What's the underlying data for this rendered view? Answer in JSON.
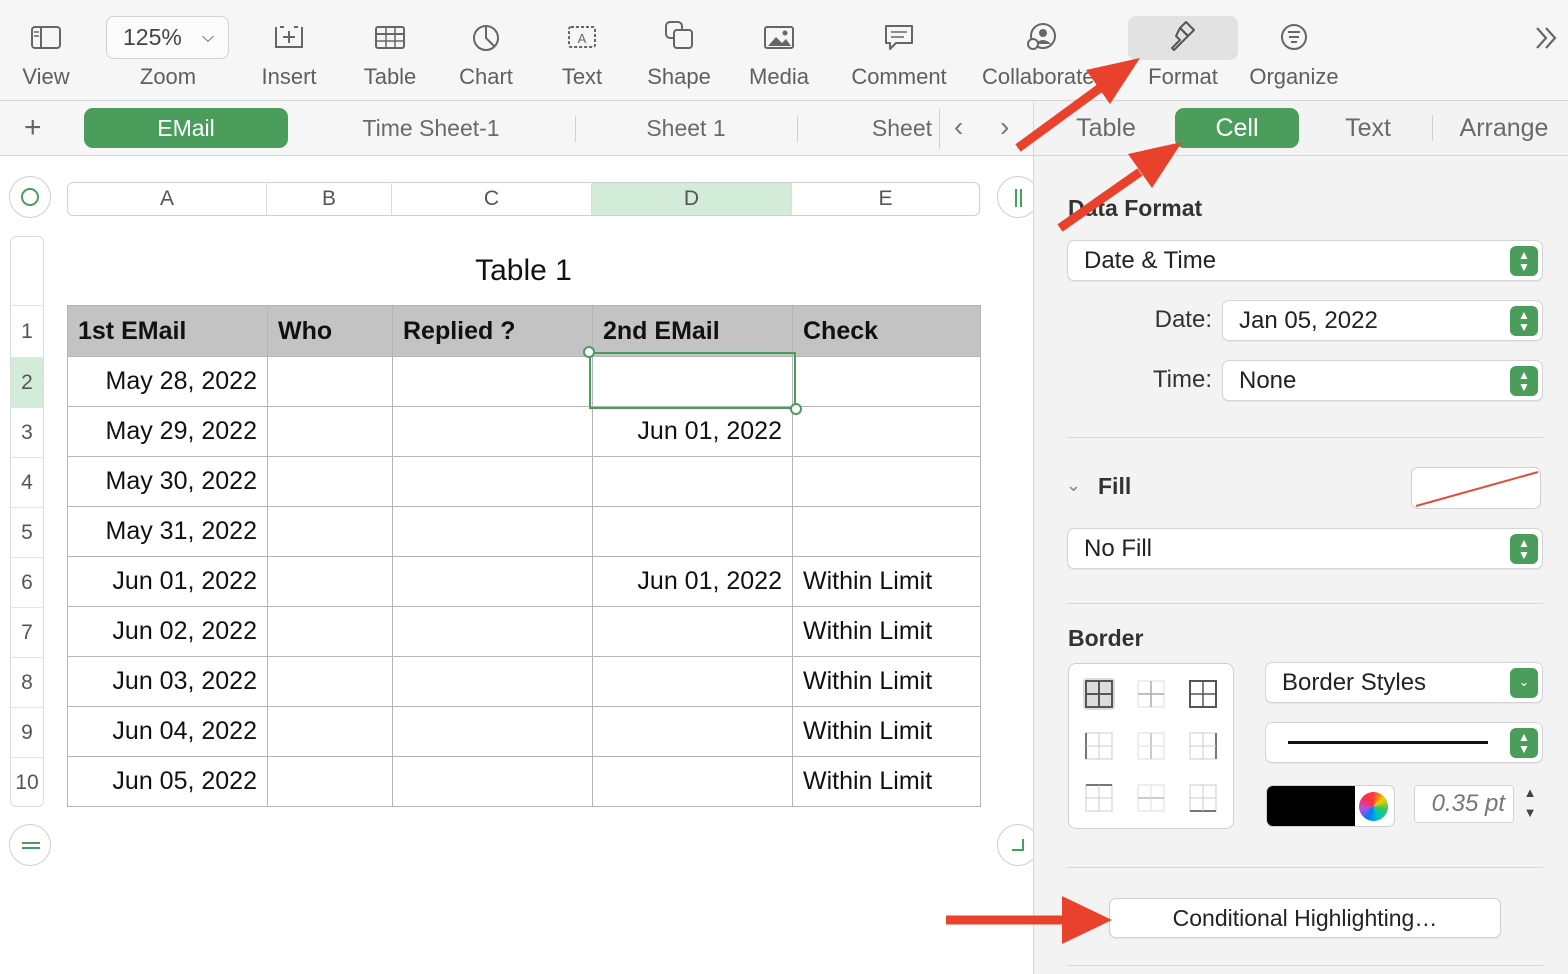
{
  "toolbar": {
    "zoom_value": "125%",
    "items": [
      {
        "label": "View",
        "icon": "sidebar-icon"
      },
      {
        "label": "Zoom"
      },
      {
        "label": "Insert",
        "icon": "insert-icon"
      },
      {
        "label": "Table",
        "icon": "table-icon"
      },
      {
        "label": "Chart",
        "icon": "chart-icon"
      },
      {
        "label": "Text",
        "icon": "text-icon"
      },
      {
        "label": "Shape",
        "icon": "shape-icon"
      },
      {
        "label": "Media",
        "icon": "media-icon"
      },
      {
        "label": "Comment",
        "icon": "comment-icon"
      },
      {
        "label": "Collaborate",
        "icon": "collaborate-icon"
      },
      {
        "label": "Format",
        "icon": "paintbrush-icon"
      },
      {
        "label": "Organize",
        "icon": "organize-icon"
      }
    ],
    "more_icon": "double-chevron-icon"
  },
  "sheets": {
    "tabs": [
      "EMail",
      "Time Sheet-1",
      "Sheet 1",
      "Sheet"
    ],
    "active": "EMail"
  },
  "inspector": {
    "tabs": [
      "Table",
      "Cell",
      "Text",
      "Arrange"
    ],
    "active_tab": "Cell",
    "data_format": {
      "title": "Data Format",
      "value": "Date & Time",
      "date_label": "Date:",
      "date_value": "Jan 05, 2022",
      "time_label": "Time:",
      "time_value": "None"
    },
    "fill": {
      "title": "Fill",
      "value": "No Fill"
    },
    "border": {
      "title": "Border",
      "styles_value": "Border Styles",
      "width_value": "0.35 pt",
      "color": "#000000"
    },
    "conditional_button": "Conditional Highlighting…"
  },
  "sheet": {
    "title": "Table 1",
    "columns": [
      "A",
      "B",
      "C",
      "D",
      "E"
    ],
    "selected_column": "D",
    "selected_row": "2",
    "row_numbers": [
      "1",
      "2",
      "3",
      "4",
      "5",
      "6",
      "7",
      "8",
      "9",
      "10"
    ],
    "headers": [
      "1st EMail",
      "Who",
      "Replied ?",
      "2nd EMail",
      "Check"
    ],
    "rows": [
      [
        "May 28, 2022",
        "",
        "",
        "",
        ""
      ],
      [
        "May 29, 2022",
        "",
        "",
        "Jun 01, 2022",
        ""
      ],
      [
        "May 30, 2022",
        "",
        "",
        "",
        ""
      ],
      [
        "May 31, 2022",
        "",
        "",
        "",
        ""
      ],
      [
        "Jun 01, 2022",
        "",
        "",
        "Jun 01, 2022",
        "Within Limit"
      ],
      [
        "Jun 02, 2022",
        "",
        "",
        "",
        "Within Limit"
      ],
      [
        "Jun 03, 2022",
        "",
        "",
        "",
        "Within Limit"
      ],
      [
        "Jun 04, 2022",
        "",
        "",
        "",
        "Within Limit"
      ],
      [
        "Jun 05, 2022",
        "",
        "",
        "",
        "Within Limit"
      ]
    ]
  },
  "colors": {
    "accent": "#4a9d5a",
    "header_fill": "#c3c3c3",
    "annotation_arrow": "#e8412c"
  }
}
